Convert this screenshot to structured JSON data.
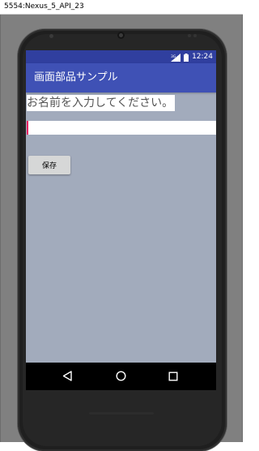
{
  "window": {
    "title": "5554:Nexus_5_API_23"
  },
  "status_bar": {
    "time": "12:24",
    "network_label": "3G",
    "icons": [
      "signal-icon",
      "battery-icon"
    ]
  },
  "app_bar": {
    "title": "画面部品サンプル"
  },
  "form": {
    "name_label": "お名前を入力してください。",
    "name_input_value": "",
    "save_button_label": "保存"
  },
  "nav_bar": {
    "buttons": [
      "back-icon",
      "home-icon",
      "recents-icon"
    ]
  },
  "colors": {
    "status_bar": "#303f9f",
    "app_bar": "#3f51b5",
    "screen_background": "#a2abbc",
    "input_accent": "#e91e63"
  }
}
